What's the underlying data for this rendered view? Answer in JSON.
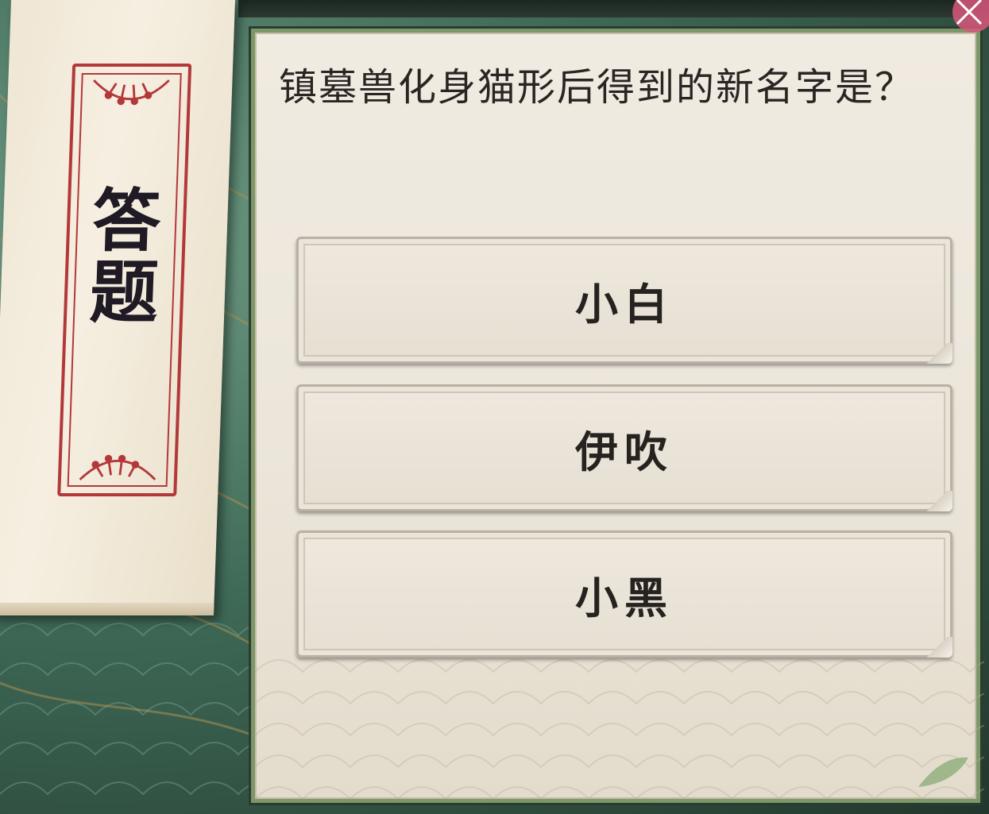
{
  "scroll": {
    "title_chars": [
      "答",
      "题"
    ]
  },
  "quiz": {
    "question": "镇墓兽化身猫形后得到的新名字是？",
    "options": [
      {
        "label": "小白"
      },
      {
        "label": "伊吹"
      },
      {
        "label": "小黑"
      }
    ]
  },
  "colors": {
    "panel_border": "#7c9868",
    "seal_red": "#b3383a",
    "text_dark": "#26221f"
  }
}
